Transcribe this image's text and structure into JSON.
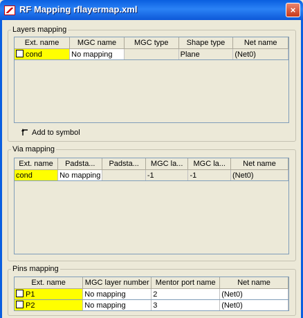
{
  "window": {
    "title": "RF Mapping rflayermap.xml",
    "close_label": "×"
  },
  "layers": {
    "legend": "Layers mapping",
    "columns": [
      "Ext. name",
      "MGC name",
      "MGC type",
      "Shape type",
      "Net name"
    ],
    "rows": [
      {
        "ext": "cond",
        "mgc_name": "No mapping",
        "mgc_type": "",
        "shape_type": "Plane",
        "net": "(Net0)"
      }
    ],
    "add_label": "Add to symbol"
  },
  "via": {
    "legend": "Via mapping",
    "columns": [
      "Ext. name",
      "Padsta...",
      "Padsta...",
      "MGC la...",
      "MGC la...",
      "Net name"
    ],
    "rows": [
      {
        "ext": "cond",
        "pad1": "No mapping",
        "pad2": "",
        "la1": "-1",
        "la2": "-1",
        "net": "(Net0)"
      }
    ]
  },
  "pins": {
    "legend": "Pins mapping",
    "columns": [
      "Ext. name",
      "MGC layer number",
      "Mentor port name",
      "Net name"
    ],
    "rows": [
      {
        "ext": "P1",
        "layer": "No mapping",
        "port": "2",
        "net": "(Net0)"
      },
      {
        "ext": "P2",
        "layer": "No mapping",
        "port": "3",
        "net": "(Net0)"
      }
    ]
  }
}
